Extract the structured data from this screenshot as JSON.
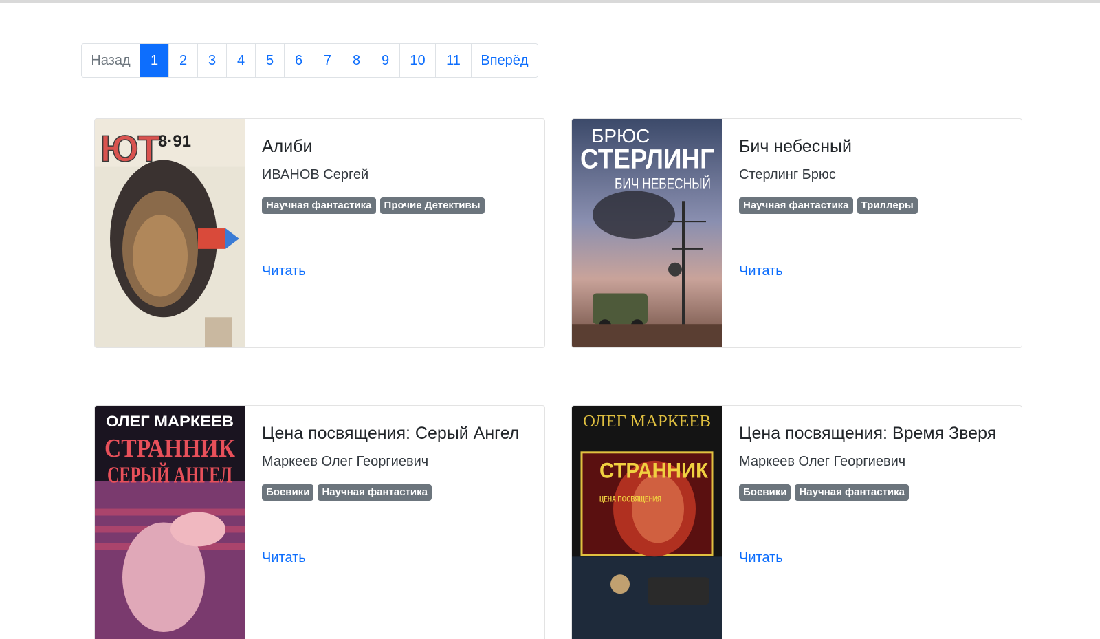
{
  "pagination": {
    "prev": "Назад",
    "pages": [
      "1",
      "2",
      "3",
      "4",
      "5",
      "6",
      "7",
      "8",
      "9",
      "10",
      "11"
    ],
    "active": "1",
    "next": "Вперёд"
  },
  "books": [
    {
      "title": "Алиби",
      "author": "ИВАНОВ Сергей",
      "tags": [
        "Научная фантастика",
        "Прочие Детективы"
      ],
      "read_label": "Читать",
      "cover": {
        "line1": "ЮТ",
        "line2": "8·91",
        "line3": ""
      }
    },
    {
      "title": "Бич небесный",
      "author": "Стерлинг Брюс",
      "tags": [
        "Научная фантастика",
        "Триллеры"
      ],
      "read_label": "Читать",
      "cover": {
        "line1": "БРЮС",
        "line2": "СТЕРЛИНГ",
        "line3": "БИЧ НЕБЕСНЫЙ"
      }
    },
    {
      "title": "Цена посвящения: Серый Ангел",
      "author": "Маркеев Олег Георгиевич",
      "tags": [
        "Боевики",
        "Научная фантастика"
      ],
      "read_label": "Читать",
      "cover": {
        "line1": "ОЛЕГ МАРКЕЕВ",
        "line2": "СТРАННИК",
        "line3": "СЕРЫЙ АНГЕЛ"
      }
    },
    {
      "title": "Цена посвящения: Время Зверя",
      "author": "Маркеев Олег Георгиевич",
      "tags": [
        "Боевики",
        "Научная фантастика"
      ],
      "read_label": "Читать",
      "cover": {
        "line1": "ОЛЕГ МАРКЕЕВ",
        "line2": "СТРАННИК",
        "line3": "ЦЕНА ПОСВЯЩЕНИЯ"
      }
    }
  ]
}
